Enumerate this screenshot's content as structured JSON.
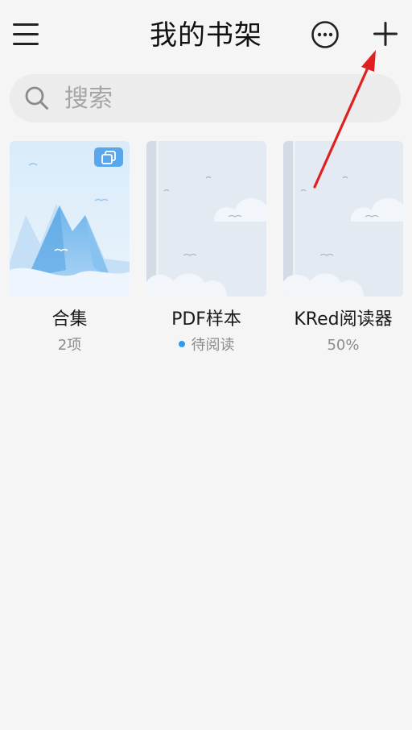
{
  "header": {
    "title": "我的书架",
    "menu_icon": "hamburger-menu-icon",
    "more_icon": "more-options-icon",
    "add_icon": "plus-icon"
  },
  "search": {
    "placeholder": "搜索",
    "value": ""
  },
  "books": [
    {
      "title": "合集",
      "subtitle": "2项",
      "type": "collection"
    },
    {
      "title": "PDF样本",
      "subtitle": "待阅读",
      "status_dot": true
    },
    {
      "title": "KRed阅读器",
      "subtitle": "50%"
    }
  ],
  "colors": {
    "background": "#f5f5f5",
    "search_bg": "#ececec",
    "accent_blue": "#2e9bf0",
    "annotation_arrow": "#e02020"
  }
}
